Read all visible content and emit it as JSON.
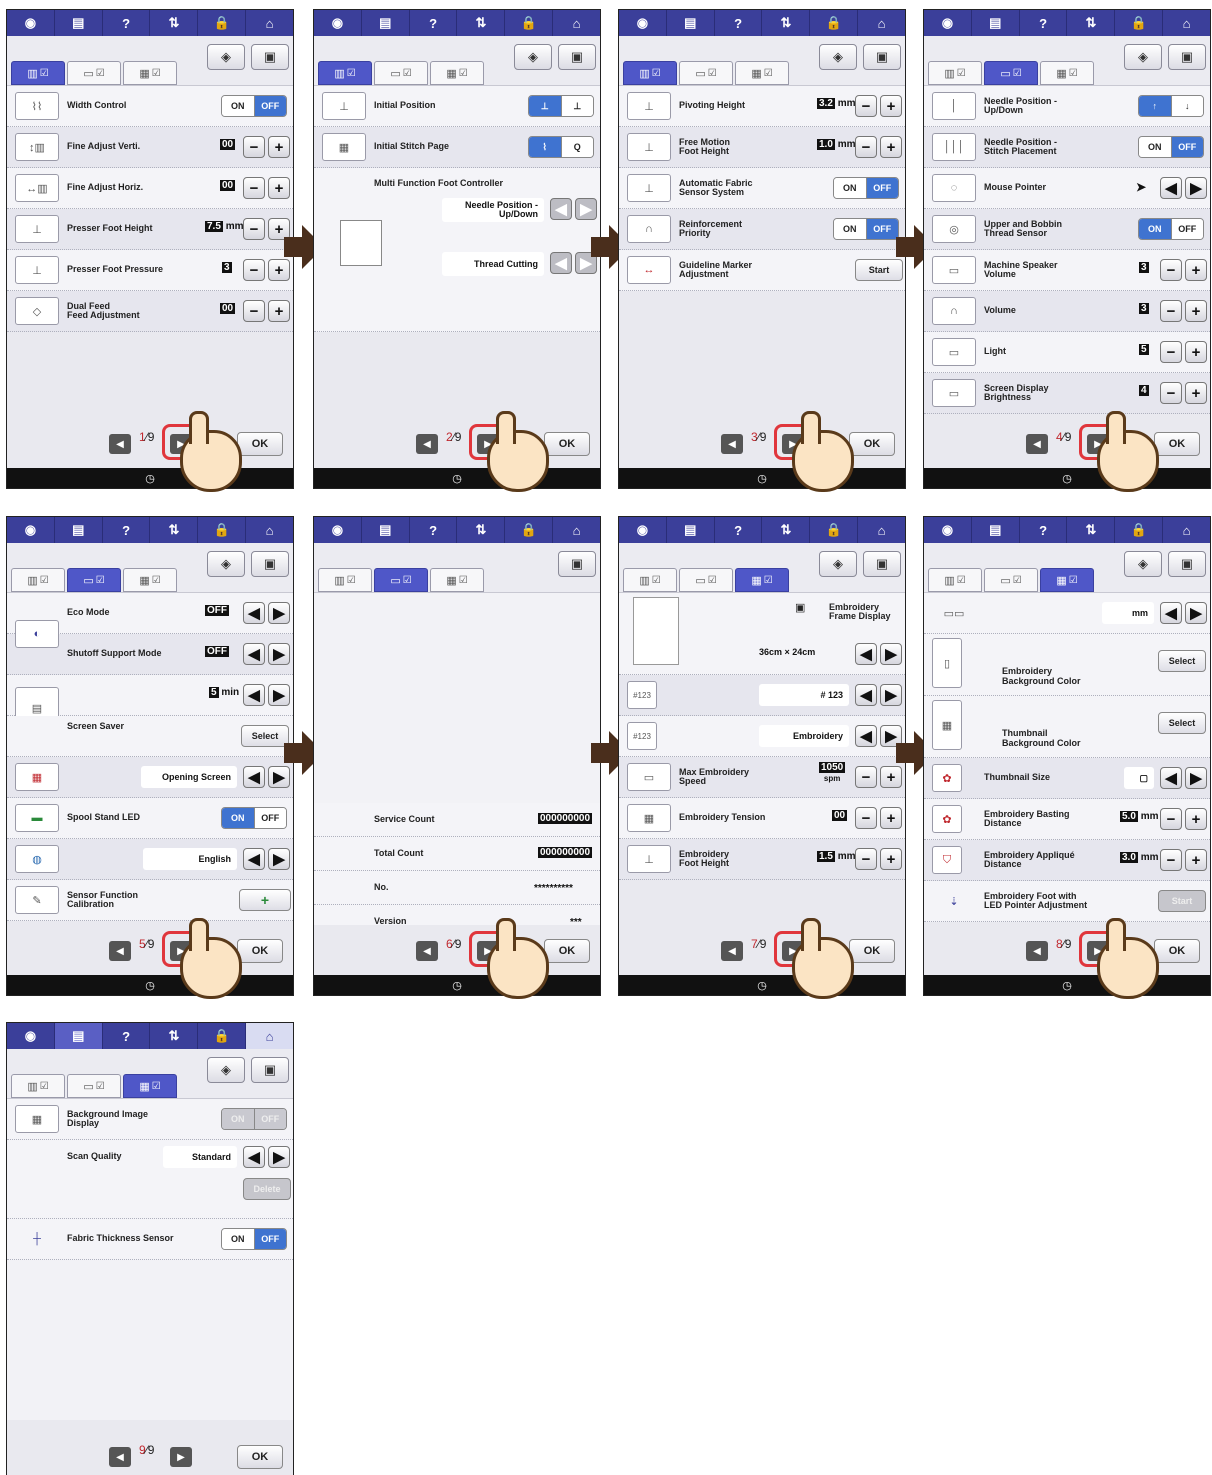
{
  "common": {
    "top_icons": [
      "camera-icon",
      "page-icon",
      "help-icon",
      "needle-thread-icon",
      "lock-icon",
      "home-icon"
    ],
    "top_glyphs": [
      "◉",
      "▤",
      "?",
      "⇅",
      "🔒",
      "⌂"
    ],
    "ok_label": "OK",
    "total_pages": "9",
    "unit_mm": "mm"
  },
  "screens": [
    {
      "page": "1",
      "rows": [
        {
          "label": "Width Control",
          "ctrl": "onoff",
          "on": "ON",
          "off": "OFF",
          "active": "off"
        },
        {
          "label": "Fine Adjust Verti.",
          "ctrl": "pm",
          "value": "00"
        },
        {
          "label": "Fine Adjust Horiz.",
          "ctrl": "pm",
          "value": "00"
        },
        {
          "label": "Presser Foot Height",
          "ctrl": "pm",
          "value": "7.5",
          "unit": "mm"
        },
        {
          "label": "Presser Foot Pressure",
          "ctrl": "pm",
          "value": "3"
        },
        {
          "label": "Dual Feed\nFeed Adjustment",
          "ctrl": "pm",
          "value": "00"
        }
      ]
    },
    {
      "page": "2",
      "rows": [
        {
          "label": "Initial Position"
        },
        {
          "label": "Initial Stitch Page"
        }
      ],
      "mfc_title": "Multi Function Foot Controller",
      "mfc_opt1": "Needle Position -\nUp/Down",
      "mfc_opt2": "Thread Cutting"
    },
    {
      "page": "3",
      "rows": [
        {
          "label": "Pivoting Height",
          "value": "3.2",
          "unit": "mm"
        },
        {
          "label": "Free Motion\nFoot Height",
          "value": "1.0",
          "unit": "mm"
        },
        {
          "label": "Automatic Fabric\nSensor System",
          "on": "ON",
          "off": "OFF"
        },
        {
          "label": "Reinforcement\nPriority",
          "on": "ON",
          "off": "OFF"
        },
        {
          "label": "Guideline Marker\nAdjustment",
          "button": "Start"
        }
      ]
    },
    {
      "page": "4",
      "rows": [
        {
          "label": "Needle Position -\nUp/Down"
        },
        {
          "label": "Needle Position -\nStitch Placement",
          "on": "ON",
          "off": "OFF"
        },
        {
          "label": "Mouse Pointer"
        },
        {
          "label": "Upper and Bobbin\nThread Sensor",
          "on": "ON",
          "off": "OFF"
        },
        {
          "label": "Machine Speaker\nVolume",
          "value": "3"
        },
        {
          "label": "Volume",
          "value": "3"
        },
        {
          "label": "Light",
          "value": "5"
        },
        {
          "label": "Screen Display\nBrightness",
          "value": "4"
        }
      ]
    },
    {
      "page": "5",
      "rows": [
        {
          "label": "Eco Mode",
          "value": "OFF"
        },
        {
          "label": "Shutoff Support Mode",
          "value": "OFF"
        },
        {
          "label": "",
          "value": "5",
          "unit": "min"
        },
        {
          "label": "Screen Saver",
          "button": "Select"
        },
        {
          "label": "",
          "value": "Opening Screen"
        },
        {
          "label": "Spool Stand LED",
          "on": "ON",
          "off": "OFF"
        },
        {
          "label": "",
          "value": "English"
        },
        {
          "label": "Sensor Function\nCalibration",
          "button": "+"
        }
      ]
    },
    {
      "page": "6",
      "rows": [
        {
          "label": "Service Count",
          "value": "000000000"
        },
        {
          "label": "Total Count",
          "value": "000000000"
        },
        {
          "label": "No.",
          "value": "**********"
        },
        {
          "label": "Version",
          "value": "***"
        }
      ]
    },
    {
      "page": "7",
      "frame_label": "Embroidery\nFrame Display",
      "frame_size": "36cm × ",
      "frame_size2": "24cm",
      "rows": [
        {
          "label": "",
          "value": "# 123"
        },
        {
          "label": "",
          "value": "Embroidery"
        },
        {
          "label": "Max Embroidery\nSpeed",
          "value": "1050",
          "unit": "spm"
        },
        {
          "label": "Embroidery Tension",
          "value": "00"
        },
        {
          "label": "Embroidery\nFoot Height",
          "value": "1.5",
          "unit": "mm"
        }
      ]
    },
    {
      "page": "8",
      "rows": [
        {
          "label": "",
          "value": "mm"
        },
        {
          "label": "Embroidery\nBackground Color",
          "button": "Select"
        },
        {
          "label": "Thumbnail\nBackground Color",
          "button": "Select"
        },
        {
          "label": "Thumbnail Size"
        },
        {
          "label": "Embroidery Basting\nDistance",
          "value": "5.0",
          "unit": "mm"
        },
        {
          "label": "Embroidery Appliqué\nDistance",
          "value": "3.0",
          "unit": "mm"
        },
        {
          "label": "Embroidery Foot with\nLED Pointer Adjustment",
          "button": "Start"
        }
      ]
    },
    {
      "page": "9",
      "rows": [
        {
          "label": "Background Image\nDisplay",
          "on": "ON",
          "off": "OFF"
        },
        {
          "label": "Scan Quality",
          "value": "Standard"
        },
        {
          "label": "",
          "button": "Delete"
        },
        {
          "label": "Fabric Thickness Sensor",
          "on": "ON",
          "off": "OFF"
        }
      ]
    }
  ]
}
